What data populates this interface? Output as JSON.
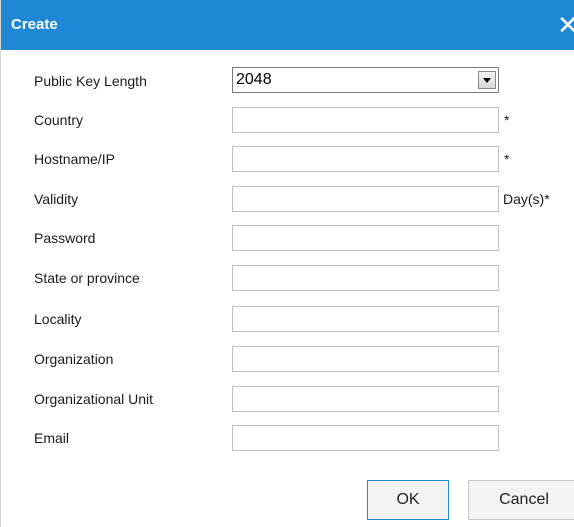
{
  "dialog": {
    "title": "Create",
    "close_glyph": "✕",
    "close_icon": "close-icon"
  },
  "form": {
    "key_length": {
      "label": "Public Key Length",
      "selected": "2048"
    },
    "country": {
      "label": "Country",
      "value": "",
      "suffix": "*"
    },
    "hostname": {
      "label": "Hostname/IP",
      "value": "",
      "suffix": "*"
    },
    "validity": {
      "label": "Validity",
      "value": "",
      "suffix": "Day(s)*"
    },
    "password": {
      "label": "Password",
      "value": ""
    },
    "state": {
      "label": "State or province",
      "value": ""
    },
    "locality": {
      "label": "Locality",
      "value": ""
    },
    "organization": {
      "label": "Organization",
      "value": ""
    },
    "org_unit": {
      "label": "Organizational Unit",
      "value": ""
    },
    "email": {
      "label": "Email",
      "value": ""
    }
  },
  "buttons": {
    "ok": "OK",
    "cancel": "Cancel"
  },
  "colors": {
    "title_bar": "#1e88d6",
    "ok_border": "#1e88d6"
  }
}
